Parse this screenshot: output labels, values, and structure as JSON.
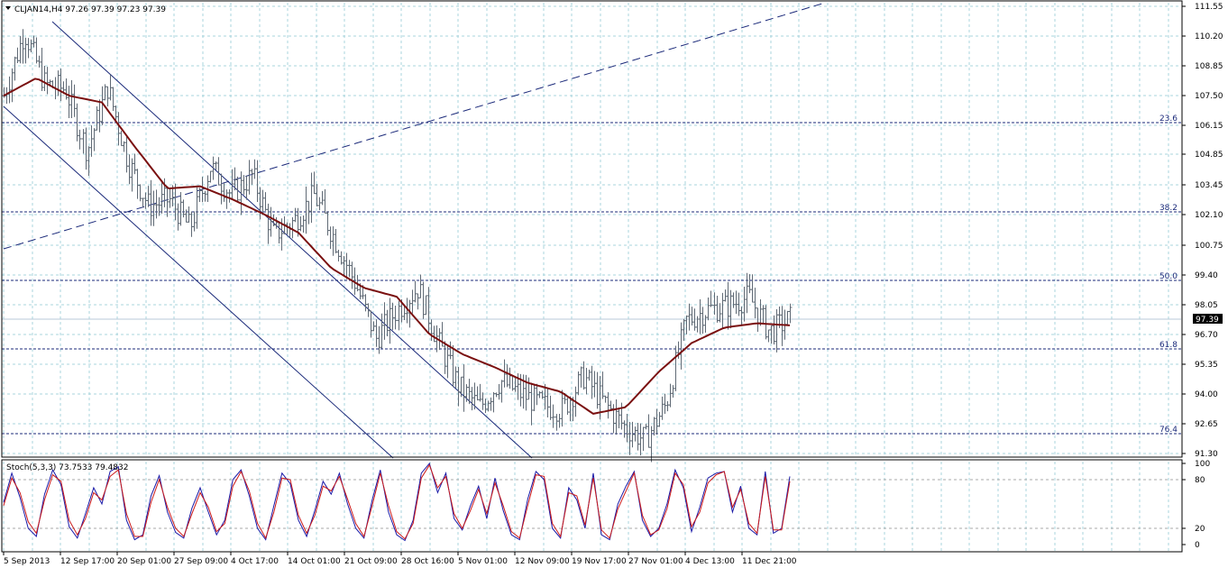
{
  "chart_data": [
    {
      "type": "candlestick",
      "title": "CLJAN14,H4  97.26 97.39 97.23 97.39",
      "symbol": "CLJAN14",
      "timeframe": "H4",
      "ohlc_header": "97.26 97.39 97.23 97.39",
      "last_price": "97.39",
      "ylim": [
        91.0,
        111.6
      ],
      "y_ticks": [
        "111.55",
        "110.20",
        "108.85",
        "107.50",
        "106.15",
        "104.85",
        "103.45",
        "102.10",
        "100.75",
        "99.40",
        "98.05",
        "96.70",
        "95.35",
        "94.00",
        "92.65",
        "91.30"
      ],
      "x_ticks": [
        "5 Sep 2013",
        "12 Sep 17:00",
        "20 Sep 01:00",
        "27 Sep 09:00",
        "4 Oct 17:00",
        "14 Oct 01:00",
        "21 Oct 09:00",
        "28 Oct 16:00",
        "5 Nov 01:00",
        "12 Nov 09:00",
        "19 Nov 17:00",
        "27 Nov 01:00",
        "4 Dec 13:00",
        "11 Dec 21:00"
      ],
      "fib_levels": [
        {
          "label": "23.6",
          "value": 106.3
        },
        {
          "label": "38.2",
          "value": 102.25
        },
        {
          "label": "50.0",
          "value": 99.15
        },
        {
          "label": "61.8",
          "value": 96.05
        },
        {
          "label": "76.4",
          "value": 92.2
        }
      ],
      "close_path": [
        {
          "x": "5 Sep 2013",
          "y": 107.5
        },
        {
          "x": "7 Sep",
          "y": 110.4
        },
        {
          "x": "9 Sep",
          "y": 108.0
        },
        {
          "x": "11 Sep",
          "y": 107.8
        },
        {
          "x": "13 Sep",
          "y": 105.0
        },
        {
          "x": "16 Sep",
          "y": 107.9
        },
        {
          "x": "18 Sep",
          "y": 104.5
        },
        {
          "x": "20 Sep",
          "y": 102.5
        },
        {
          "x": "24 Sep",
          "y": 102.8
        },
        {
          "x": "27 Sep",
          "y": 101.5
        },
        {
          "x": "1 Oct",
          "y": 104.3
        },
        {
          "x": "4 Oct",
          "y": 103.0
        },
        {
          "x": "7 Oct",
          "y": 103.9
        },
        {
          "x": "9 Oct",
          "y": 101.2
        },
        {
          "x": "12 Oct",
          "y": 101.8
        },
        {
          "x": "15 Oct",
          "y": 103.0
        },
        {
          "x": "18 Oct",
          "y": 101.0
        },
        {
          "x": "21 Oct",
          "y": 99.0
        },
        {
          "x": "23 Oct",
          "y": 96.5
        },
        {
          "x": "26 Oct",
          "y": 97.8
        },
        {
          "x": "28 Oct",
          "y": 98.8
        },
        {
          "x": "31 Oct",
          "y": 96.3
        },
        {
          "x": "3 Nov",
          "y": 94.3
        },
        {
          "x": "5 Nov",
          "y": 93.4
        },
        {
          "x": "8 Nov",
          "y": 94.6
        },
        {
          "x": "11 Nov",
          "y": 94.0
        },
        {
          "x": "14 Nov",
          "y": 93.5
        },
        {
          "x": "18 Nov",
          "y": 93.3
        },
        {
          "x": "21 Nov",
          "y": 94.8
        },
        {
          "x": "24 Nov",
          "y": 93.6
        },
        {
          "x": "26 Nov",
          "y": 92.5
        },
        {
          "x": "28 Nov",
          "y": 91.9
        },
        {
          "x": "2 Dec",
          "y": 93.5
        },
        {
          "x": "4 Dec",
          "y": 97.3
        },
        {
          "x": "6 Dec",
          "y": 97.8
        },
        {
          "x": "9 Dec",
          "y": 98.0
        },
        {
          "x": "11 Dec",
          "y": 98.4
        },
        {
          "x": "13 Dec",
          "y": 96.8
        },
        {
          "x": "15 Dec",
          "y": 97.39
        }
      ],
      "moving_average_path": [
        {
          "x": "5 Sep 2013",
          "y": 107.5
        },
        {
          "x": "9 Sep",
          "y": 108.3
        },
        {
          "x": "13 Sep",
          "y": 107.5
        },
        {
          "x": "17 Sep",
          "y": 107.2
        },
        {
          "x": "20 Sep",
          "y": 105.2
        },
        {
          "x": "27 Sep",
          "y": 103.3
        },
        {
          "x": "4 Oct",
          "y": 103.4
        },
        {
          "x": "11 Oct",
          "y": 102.8
        },
        {
          "x": "15 Oct",
          "y": 102.1
        },
        {
          "x": "18 Oct",
          "y": 101.3
        },
        {
          "x": "21 Oct",
          "y": 99.7
        },
        {
          "x": "25 Oct",
          "y": 98.8
        },
        {
          "x": "28 Oct",
          "y": 98.4
        },
        {
          "x": "1 Nov",
          "y": 96.7
        },
        {
          "x": "5 Nov",
          "y": 95.8
        },
        {
          "x": "11 Nov",
          "y": 95.2
        },
        {
          "x": "19 Nov",
          "y": 94.5
        },
        {
          "x": "25 Nov",
          "y": 94.1
        },
        {
          "x": "29 Nov",
          "y": 93.1
        },
        {
          "x": "3 Dec",
          "y": 93.4
        },
        {
          "x": "6 Dec",
          "y": 95.0
        },
        {
          "x": "9 Dec",
          "y": 96.3
        },
        {
          "x": "11 Dec",
          "y": 97.0
        },
        {
          "x": "13 Dec",
          "y": 97.2
        },
        {
          "x": "15 Dec",
          "y": 97.1
        }
      ]
    },
    {
      "type": "line",
      "title": "Stoch(5,3,3) 73.7533 79.4832",
      "ylim": [
        0,
        100
      ],
      "y_ticks": [
        "100",
        "80",
        "20",
        "0"
      ],
      "levels": [
        80,
        20
      ],
      "series": [
        {
          "name": "73.7533",
          "color": "#1a1aa8",
          "values": [
            52,
            88,
            58,
            20,
            10,
            62,
            92,
            74,
            22,
            8,
            38,
            70,
            50,
            90,
            96,
            30,
            6,
            12,
            60,
            85,
            40,
            15,
            8,
            45,
            70,
            40,
            12,
            30,
            80,
            92,
            60,
            20,
            6,
            48,
            88,
            75,
            30,
            10,
            42,
            78,
            62,
            88,
            50,
            20,
            8,
            55,
            92,
            40,
            12,
            5,
            30,
            88,
            100,
            64,
            88,
            32,
            18,
            48,
            72,
            32,
            82,
            42,
            12,
            6,
            56,
            90,
            80,
            20,
            8,
            70,
            55,
            20,
            88,
            12,
            6,
            50,
            72,
            90,
            30,
            10,
            20,
            50,
            92,
            70,
            16,
            46,
            82,
            88,
            90,
            40,
            72,
            20,
            12,
            90,
            14,
            20,
            84
          ]
        },
        {
          "name": "79.4832",
          "color": "#cc1a1a",
          "values": [
            48,
            82,
            64,
            28,
            14,
            55,
            86,
            78,
            30,
            12,
            32,
            64,
            55,
            84,
            92,
            38,
            10,
            10,
            52,
            80,
            46,
            20,
            10,
            38,
            64,
            46,
            16,
            26,
            72,
            90,
            66,
            26,
            8,
            40,
            82,
            80,
            36,
            14,
            36,
            72,
            66,
            84,
            56,
            26,
            10,
            48,
            88,
            48,
            16,
            7,
            26,
            82,
            98,
            70,
            84,
            38,
            20,
            42,
            68,
            38,
            76,
            48,
            16,
            8,
            48,
            86,
            84,
            26,
            10,
            64,
            60,
            24,
            82,
            18,
            8,
            44,
            66,
            88,
            36,
            12,
            18,
            44,
            88,
            74,
            22,
            40,
            76,
            86,
            90,
            46,
            68,
            26,
            14,
            84,
            18,
            18,
            78
          ]
        }
      ]
    }
  ]
}
